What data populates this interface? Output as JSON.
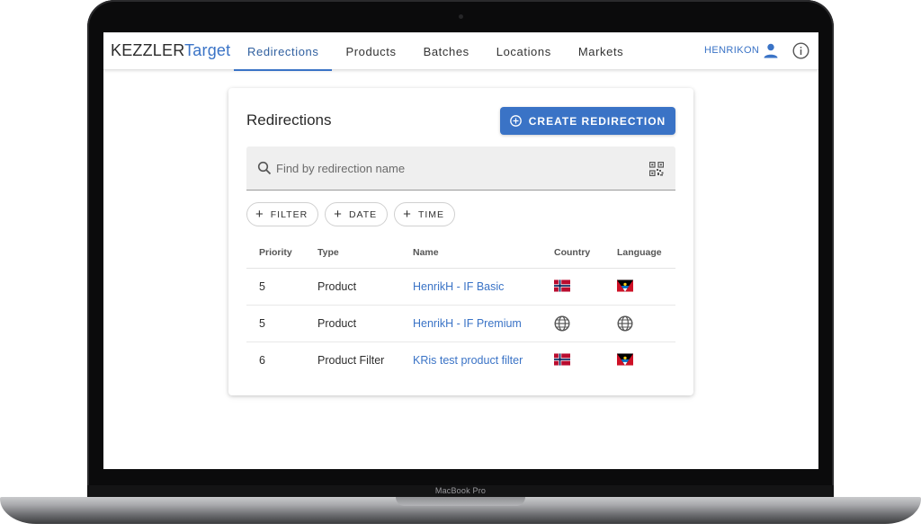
{
  "device": {
    "label": "MacBook Pro"
  },
  "header": {
    "brand_main": "KEZZLER",
    "brand_accent": "Target",
    "tabs": [
      {
        "label": "Redirections",
        "active": true
      },
      {
        "label": "Products",
        "active": false
      },
      {
        "label": "Batches",
        "active": false
      },
      {
        "label": "Locations",
        "active": false
      },
      {
        "label": "Markets",
        "active": false
      }
    ],
    "username": "HENRIKON",
    "user_icon": "person-icon",
    "info_icon": "info-icon"
  },
  "card": {
    "title": "Redirections",
    "create_button": "CREATE REDIRECTION",
    "search_placeholder": "Find by redirection name",
    "chips": [
      "FILTER",
      "DATE",
      "TIME"
    ],
    "columns": [
      "Priority",
      "Type",
      "Name",
      "Country",
      "Language"
    ],
    "rows": [
      {
        "priority": "5",
        "type": "Product",
        "name": "HenrikH - IF Basic",
        "country": "flag-norway",
        "language": "flag-antigua-barbuda"
      },
      {
        "priority": "5",
        "type": "Product",
        "name": "HenrikH - IF Premium",
        "country": "globe",
        "language": "globe"
      },
      {
        "priority": "6",
        "type": "Product Filter",
        "name": "KRis test product filter",
        "country": "flag-norway",
        "language": "flag-antigua-barbuda"
      }
    ]
  },
  "colors": {
    "accent": "#3a73c6",
    "text": "#2e2e2e",
    "search_bg": "#efefef"
  }
}
